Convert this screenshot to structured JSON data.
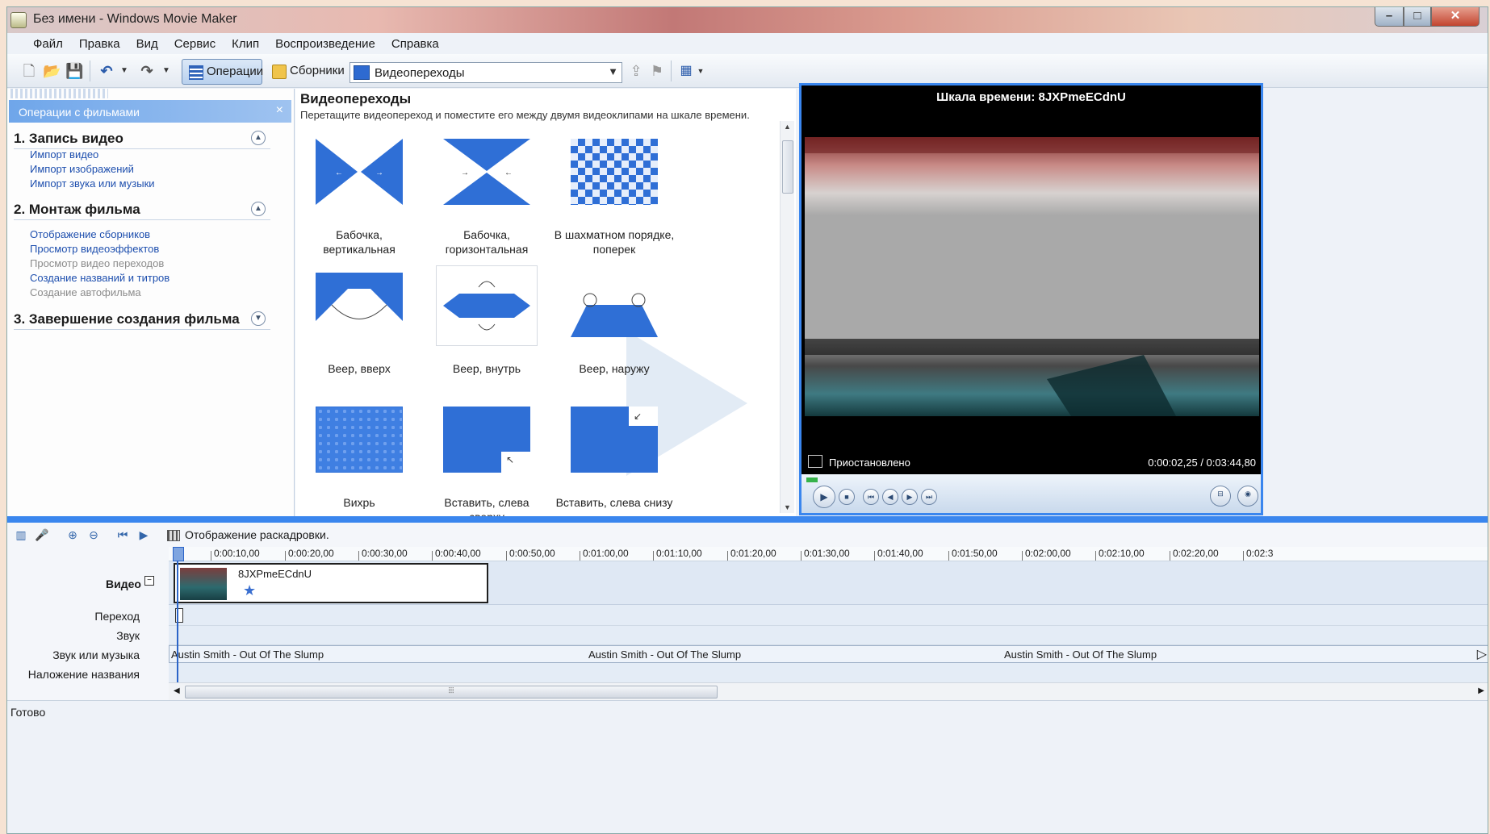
{
  "window": {
    "title": "Без имени - Windows Movie Maker"
  },
  "menu": [
    "Файл",
    "Правка",
    "Вид",
    "Сервис",
    "Клип",
    "Воспроизведение",
    "Справка"
  ],
  "toolbar": {
    "operations_label": "Операции",
    "collections_label": "Сборники",
    "combo_value": "Видеопереходы"
  },
  "tasks_panel": {
    "header": "Операции с фильмами",
    "sections": [
      {
        "title": "1. Запись видео",
        "items": [
          {
            "label": "Импорт видео",
            "enabled": true
          },
          {
            "label": "Импорт изображений",
            "enabled": true
          },
          {
            "label": "Импорт звука или музыки",
            "enabled": true
          }
        ]
      },
      {
        "title": "2. Монтаж фильма",
        "items": [
          {
            "label": "Отображение сборников",
            "enabled": true
          },
          {
            "label": "Просмотр видеоэффектов",
            "enabled": true
          },
          {
            "label": "Просмотр видео переходов",
            "enabled": false
          },
          {
            "label": "Создание названий и титров",
            "enabled": true
          },
          {
            "label": "Создание автофильма",
            "enabled": false
          }
        ]
      },
      {
        "title": "3. Завершение создания фильма",
        "items": []
      }
    ]
  },
  "content": {
    "title": "Видеопереходы",
    "description": "Перетащите видеопереход и поместите его между двумя видеоклипами на шкале времени.",
    "transitions": [
      {
        "line1": "Бабочка, вертикальная",
        "line2": ""
      },
      {
        "line1": "Бабочка,",
        "line2": "горизонтальная"
      },
      {
        "line1": "В шахматном порядке,",
        "line2": "поперек"
      },
      {
        "line1": "Веер, вверх",
        "line2": ""
      },
      {
        "line1": "Веер, внутрь",
        "line2": ""
      },
      {
        "line1": "Веер, наружу",
        "line2": ""
      },
      {
        "line1": "Вихрь",
        "line2": ""
      },
      {
        "line1": "Вставить, слева сверху",
        "line2": ""
      },
      {
        "line1": "Вставить, слева снизу",
        "line2": ""
      }
    ]
  },
  "preview": {
    "title": "Шкала времени: 8JXPmeECdnU",
    "status": "Приостановлено",
    "time": "0:00:02,25 / 0:03:44,80"
  },
  "timeline": {
    "storyboard_label": "Отображение раскадровки.",
    "ruler": [
      "0:00:10,00",
      "0:00:20,00",
      "0:00:30,00",
      "0:00:40,00",
      "0:00:50,00",
      "0:01:00,00",
      "0:01:10,00",
      "0:01:20,00",
      "0:01:30,00",
      "0:01:40,00",
      "0:01:50,00",
      "0:02:00,00",
      "0:02:10,00",
      "0:02:20,00",
      "0:02:3"
    ],
    "tracks": {
      "video": "Видео",
      "transition": "Переход",
      "audio": "Звук",
      "music": "Звук или музыка",
      "title_overlay": "Наложение названия"
    },
    "clip_name": "8JXPmeECdnU",
    "music_clips": [
      "Austin Smith - Out Of The Slump",
      "Austin Smith - Out Of The Slump",
      "Austin Smith - Out Of The Slump"
    ]
  },
  "statusbar": {
    "text": "Готово"
  }
}
